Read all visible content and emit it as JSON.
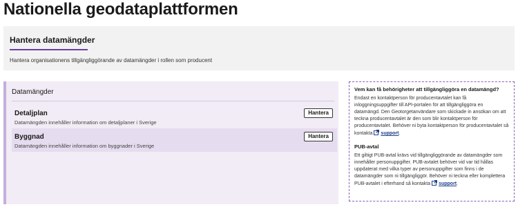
{
  "page": {
    "title": "Nationella geodataplattformen"
  },
  "hero": {
    "heading": "Hantera datamängder",
    "description": "Hantera organisationens tillgängliggörande av datamängder i rollen som producent"
  },
  "datasets": {
    "title": "Datamängder",
    "items": [
      {
        "name": "Detaljplan",
        "description": "Datamängden innehåller information om detaljplaner i Sverige",
        "button_label": "Hantera"
      },
      {
        "name": "Byggnad",
        "description": "Datamängden innehåller information om byggnader i Sverige",
        "button_label": "Hantera"
      }
    ]
  },
  "info": {
    "q1": {
      "heading": "Vem kan få behörigheter att tillgängliggöra en datamängd?",
      "text": "Endast en kontaktperson för producentavtalet kan få inloggningsuppgifter till API-portalen för att tillgängliggöra en datamängd. Den Geotorgetanvändare som skickade in ansökan om att teckna producentavtalet är den som blir kontaktperson för producentavtalet. Behöver ni byta kontaktperson för producentavtalet så kontakta",
      "link": "support"
    },
    "q2": {
      "heading": "PUB-avtal",
      "text": "Ett giltigt PUB-avtal krävs vid tillgängliggörande av datamängder som innehåller personuppgifter. PUB-avtalet behöver vid var tid hållas uppdaterat med vilka typer av personuppgifter som finns i de datamängder som ni tillgängliggör. Behöver ni teckna eller komplettera PUB-avtalet i efterhand så kontakta",
      "link": "support"
    }
  },
  "colors": {
    "accent": "#6b3fa0",
    "panel_bg": "#f1ecf5",
    "row_highlight": "#e6dcef",
    "hero_bg": "#f2f2f2",
    "link": "#1d3f8a"
  },
  "icons": {
    "external_link": "external-link-icon"
  }
}
